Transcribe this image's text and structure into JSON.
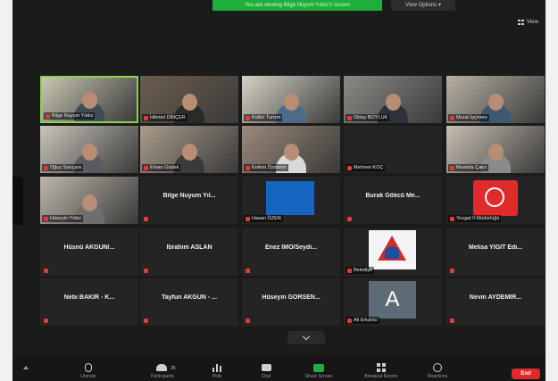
{
  "top_bar": {
    "share_banner": "You are viewing Bilge Nuyum Yıldız's screen",
    "view_options": "View Options ▾"
  },
  "view_button": {
    "label": "View"
  },
  "tiles": [
    {
      "id": "t1",
      "type": "video",
      "name": "Bilge Nuyum Yıldız",
      "active": true,
      "bg": "#c9c6b2",
      "shirt": "#3e4c58"
    },
    {
      "id": "t2",
      "type": "video",
      "name": "Hikmet DİNÇER",
      "bg": "#6b5d4e",
      "shirt": "#2a2a2a"
    },
    {
      "id": "t3",
      "type": "video",
      "name": "Kültür Turizm",
      "bg": "#d4d1c7",
      "shirt": "#4d6a88"
    },
    {
      "id": "t4",
      "type": "video",
      "name": "Oktay BOYLUK",
      "bg": "#8a8a86",
      "shirt": "#2e3238"
    },
    {
      "id": "t5",
      "type": "video",
      "name": "Murat İşçimen",
      "bg": "#b7b0a3",
      "shirt": "#3d5a74"
    },
    {
      "id": "t6",
      "type": "video",
      "name": "Oğuz Sarıçam",
      "bg": "#c8c4bc",
      "shirt": "#5a5a62"
    },
    {
      "id": "t7",
      "type": "video",
      "name": "Erhan Güdek",
      "bg": "#a89c8c",
      "shirt": "#3a3a3a"
    },
    {
      "id": "t8",
      "type": "video",
      "name": "Erdem Özdemir",
      "bg": "#9a8a7a",
      "shirt": "#d9d9d9"
    },
    {
      "id": "t9",
      "type": "empty",
      "name": "Mehmet KOÇ"
    },
    {
      "id": "t10",
      "type": "video",
      "name": "Mustafa Çakır",
      "bg": "#c7bfb3",
      "shirt": "#8a8a8a"
    },
    {
      "id": "t11",
      "type": "video",
      "name": "Hüseyin Yıldız",
      "bg": "#bdb7aa",
      "shirt": "#6e6e6e"
    },
    {
      "id": "t12",
      "type": "text",
      "name": "Bilge Nuyum Yıl..."
    },
    {
      "id": "t13",
      "type": "logo-blue",
      "name": "Hasan ÖZEN"
    },
    {
      "id": "t14",
      "type": "text",
      "name": "Burak Gökcü Me..."
    },
    {
      "id": "t15",
      "type": "logo-red",
      "name": "Yozgat İl Müdürlüğü"
    },
    {
      "id": "t16",
      "type": "text",
      "name": "Hüsnü AKGÜN/..."
    },
    {
      "id": "t17",
      "type": "text",
      "name": "İbrahim ASLAN"
    },
    {
      "id": "t18",
      "type": "text",
      "name": "Enez İMO/Seydi..."
    },
    {
      "id": "t19",
      "type": "logo-white",
      "name": "Belediye"
    },
    {
      "id": "t20",
      "type": "text",
      "name": "Melisa YİĞİT Edi..."
    },
    {
      "id": "t21",
      "type": "text",
      "name": "Nebi BAKIR - K..."
    },
    {
      "id": "t22",
      "type": "text",
      "name": "Tayfun AKGÜN - ..."
    },
    {
      "id": "t23",
      "type": "text",
      "name": "Hüseyin GÖRSEN..."
    },
    {
      "id": "t24",
      "type": "avatar",
      "name": "Ali Erkarsu",
      "letter": "A"
    },
    {
      "id": "t25",
      "type": "text",
      "name": "Nevin AYDEMİR..."
    }
  ],
  "toolbar": {
    "unmute": "Unmute",
    "participants": "Participants",
    "participants_count": "25",
    "polls": "Polls",
    "chat": "Chat",
    "share_screen": "Share Screen",
    "breakout": "Breakout Rooms",
    "reactions": "Reactions",
    "end": "End"
  },
  "colors": {
    "share_green": "#1fae39",
    "end_red": "#e02828",
    "active_speaker": "#8fd14f",
    "app_bg": "#1b1b1b"
  },
  "icons": [
    "grid-icon",
    "mic-icon",
    "participants-icon",
    "polls-icon",
    "chat-icon",
    "share-screen-icon",
    "breakout-icon",
    "reactions-icon",
    "chevron-down-icon",
    "muted-mic-icon"
  ]
}
